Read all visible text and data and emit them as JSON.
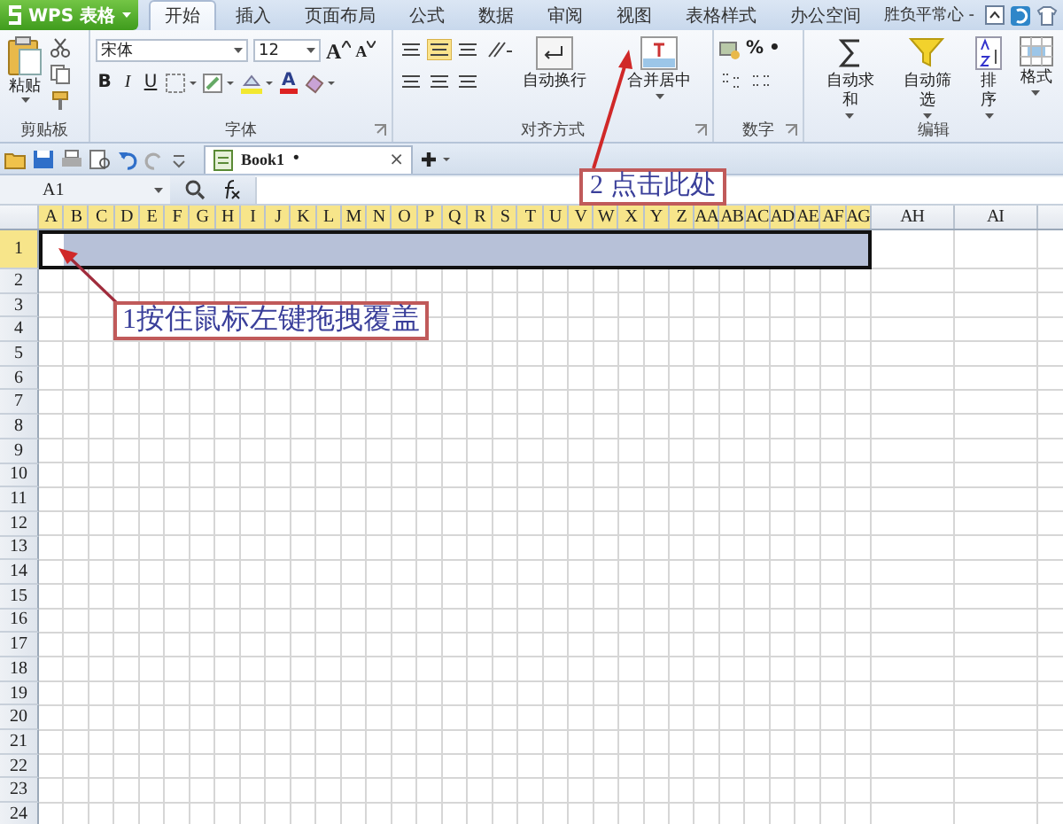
{
  "app_button": {
    "label": "WPS 表格"
  },
  "tabs": [
    {
      "label": "开始",
      "selected": true
    },
    {
      "label": "插入",
      "selected": false
    },
    {
      "label": "页面布局",
      "selected": false
    },
    {
      "label": "公式",
      "selected": false
    },
    {
      "label": "数据",
      "selected": false
    },
    {
      "label": "审阅",
      "selected": false
    },
    {
      "label": "视图",
      "selected": false
    },
    {
      "label": "表格样式",
      "selected": false
    },
    {
      "label": "办公空间",
      "selected": false
    }
  ],
  "user_name": "胜负平常心 -",
  "ribbon": {
    "clipboard": {
      "paste": "粘贴",
      "group_label": "剪贴板"
    },
    "font": {
      "font_name": "宋体",
      "font_size": "12",
      "grow_font": "A",
      "shrink_font": "A",
      "bold": "B",
      "italic": "I",
      "underline": "U",
      "font_color": "A",
      "group_label": "字体"
    },
    "alignment": {
      "wrap": "自动换行",
      "merge": "合并居中",
      "group_label": "对齐方式"
    },
    "number": {
      "percent": "%",
      "comma": "•",
      "group_label": "数字"
    },
    "editing": {
      "buttons": [
        "自动求和",
        "自动筛选",
        "排序",
        "格式"
      ],
      "group_label": "编辑"
    }
  },
  "document_tab": {
    "title": "Book1",
    "modified_mark": "•",
    "close": "×"
  },
  "name_box": "A1",
  "columns": [
    {
      "label": "A",
      "selected": true
    },
    {
      "label": "B",
      "selected": true
    },
    {
      "label": "C",
      "selected": true
    },
    {
      "label": "D",
      "selected": true
    },
    {
      "label": "E",
      "selected": true
    },
    {
      "label": "F",
      "selected": true
    },
    {
      "label": "G",
      "selected": true
    },
    {
      "label": "H",
      "selected": true
    },
    {
      "label": "I",
      "selected": true
    },
    {
      "label": "J",
      "selected": true
    },
    {
      "label": "K",
      "selected": true
    },
    {
      "label": "L",
      "selected": true
    },
    {
      "label": "M",
      "selected": true
    },
    {
      "label": "N",
      "selected": true
    },
    {
      "label": "O",
      "selected": true
    },
    {
      "label": "P",
      "selected": true
    },
    {
      "label": "Q",
      "selected": true
    },
    {
      "label": "R",
      "selected": true
    },
    {
      "label": "S",
      "selected": true
    },
    {
      "label": "T",
      "selected": true
    },
    {
      "label": "U",
      "selected": true
    },
    {
      "label": "V",
      "selected": true
    },
    {
      "label": "W",
      "selected": true
    },
    {
      "label": "X",
      "selected": true
    },
    {
      "label": "Y",
      "selected": true
    },
    {
      "label": "Z",
      "selected": true
    },
    {
      "label": "AA",
      "selected": true
    },
    {
      "label": "AB",
      "selected": true
    },
    {
      "label": "AC",
      "selected": true
    },
    {
      "label": "AD",
      "selected": true
    },
    {
      "label": "AE",
      "selected": true
    },
    {
      "label": "AF",
      "selected": true
    },
    {
      "label": "AG",
      "selected": true
    },
    {
      "label": "AH",
      "selected": false
    },
    {
      "label": "AI",
      "selected": false
    }
  ],
  "rows": [
    {
      "label": "1",
      "selected": true
    },
    {
      "label": "2",
      "selected": false
    },
    {
      "label": "3",
      "selected": false
    },
    {
      "label": "4",
      "selected": false
    },
    {
      "label": "5",
      "selected": false
    },
    {
      "label": "6",
      "selected": false
    },
    {
      "label": "7",
      "selected": false
    },
    {
      "label": "8",
      "selected": false
    },
    {
      "label": "9",
      "selected": false
    },
    {
      "label": "10",
      "selected": false
    },
    {
      "label": "11",
      "selected": false
    },
    {
      "label": "12",
      "selected": false
    },
    {
      "label": "13",
      "selected": false
    },
    {
      "label": "14",
      "selected": false
    },
    {
      "label": "15",
      "selected": false
    },
    {
      "label": "16",
      "selected": false
    },
    {
      "label": "17",
      "selected": false
    },
    {
      "label": "18",
      "selected": false
    },
    {
      "label": "19",
      "selected": false
    },
    {
      "label": "20",
      "selected": false
    },
    {
      "label": "21",
      "selected": false
    },
    {
      "label": "22",
      "selected": false
    },
    {
      "label": "23",
      "selected": false
    },
    {
      "label": "24",
      "selected": false
    }
  ],
  "annotations": [
    {
      "text": "2  点击此处"
    },
    {
      "text": "1按住鼠标左键拖拽覆盖"
    }
  ]
}
